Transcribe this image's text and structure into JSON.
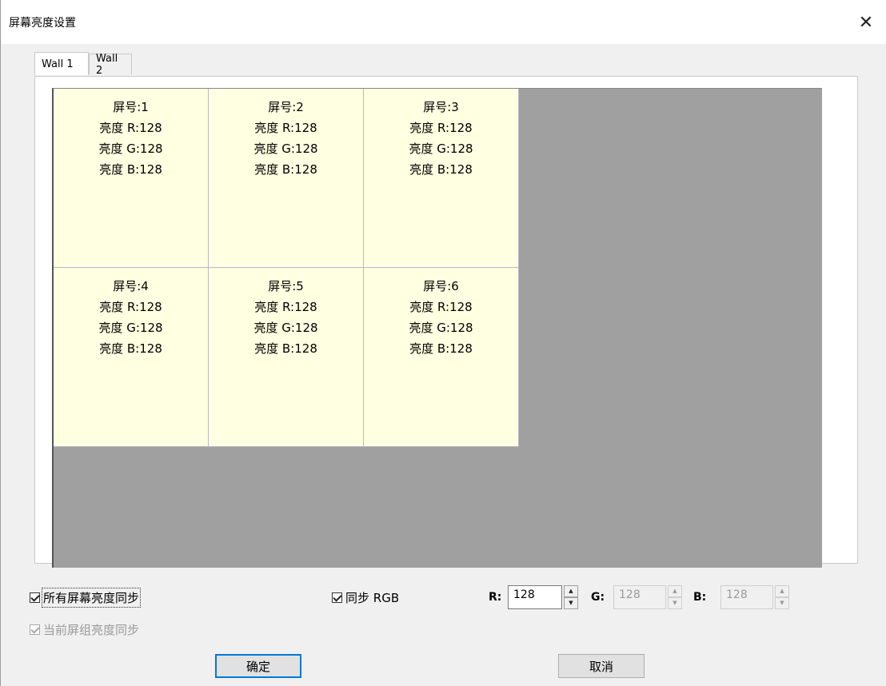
{
  "window": {
    "title": "屏幕亮度设置"
  },
  "tabs": [
    {
      "label": "Wall 1",
      "active": true
    },
    {
      "label": "Wall 2",
      "active": false
    }
  ],
  "screens": [
    {
      "name": "屏号:1",
      "r": "亮度 R:128",
      "g": "亮度 G:128",
      "b": "亮度 B:128"
    },
    {
      "name": "屏号:2",
      "r": "亮度 R:128",
      "g": "亮度 G:128",
      "b": "亮度 B:128"
    },
    {
      "name": "屏号:3",
      "r": "亮度 R:128",
      "g": "亮度 G:128",
      "b": "亮度 B:128"
    },
    {
      "name": "屏号:4",
      "r": "亮度 R:128",
      "g": "亮度 G:128",
      "b": "亮度 B:128"
    },
    {
      "name": "屏号:5",
      "r": "亮度 R:128",
      "g": "亮度 G:128",
      "b": "亮度 B:128"
    },
    {
      "name": "屏号:6",
      "r": "亮度 R:128",
      "g": "亮度 G:128",
      "b": "亮度 B:128"
    }
  ],
  "options": {
    "sync_all_label": "所有屏幕亮度同步",
    "sync_all_checked": true,
    "sync_group_label": "当前屏组亮度同步",
    "sync_group_checked": true,
    "sync_rgb_label": "同步 RGB",
    "sync_rgb_checked": true
  },
  "rgb": {
    "r_label": "R:",
    "r_value": "128",
    "g_label": "G:",
    "g_value": "128",
    "b_label": "B:",
    "b_value": "128"
  },
  "buttons": {
    "ok": "确定",
    "cancel": "取消"
  },
  "icons": {
    "close": "close-icon",
    "spin_up": "spin-up-icon",
    "spin_down": "spin-down-icon"
  },
  "colors": {
    "screen_bg": "#ffffe1",
    "wall_bg": "#a0a0a0",
    "focus_border": "#0078d7"
  }
}
